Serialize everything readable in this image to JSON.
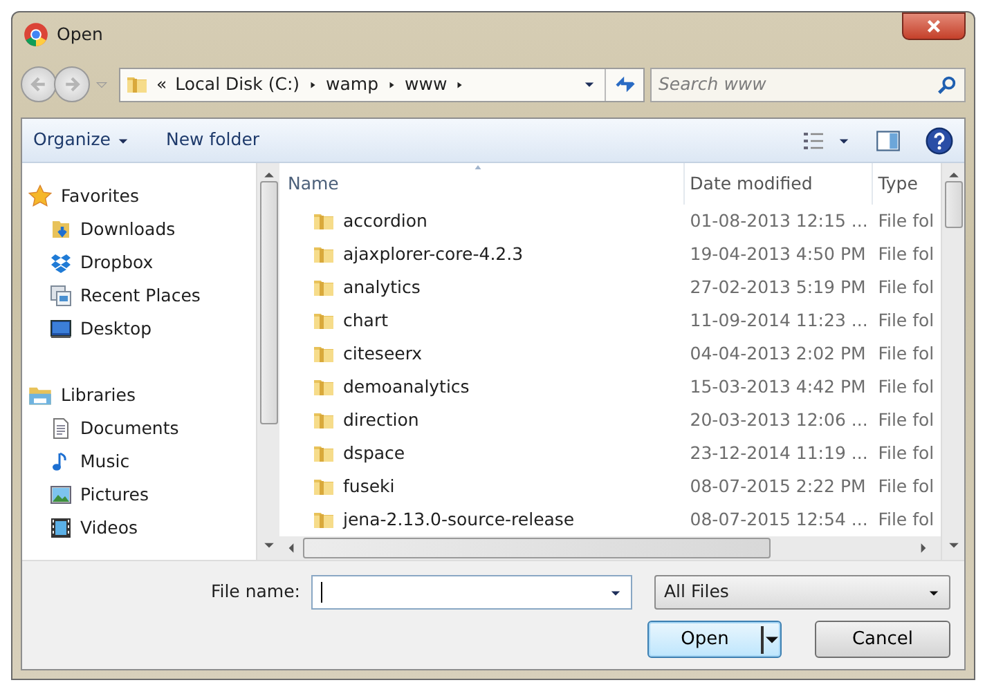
{
  "window": {
    "title": "Open"
  },
  "address": {
    "crumbs": [
      "«",
      "Local Disk (C:)",
      "wamp",
      "www"
    ]
  },
  "search": {
    "placeholder": "Search www"
  },
  "toolbar": {
    "organize": "Organize",
    "new_folder": "New folder"
  },
  "sidebar": {
    "groups": [
      {
        "label": "Favorites",
        "children": [
          {
            "label": "Downloads"
          },
          {
            "label": "Dropbox"
          },
          {
            "label": "Recent Places"
          },
          {
            "label": "Desktop"
          }
        ]
      },
      {
        "label": "Libraries",
        "children": [
          {
            "label": "Documents"
          },
          {
            "label": "Music"
          },
          {
            "label": "Pictures"
          },
          {
            "label": "Videos"
          }
        ]
      }
    ]
  },
  "table": {
    "columns": [
      "Name",
      "Date modified",
      "Type"
    ],
    "rows": [
      {
        "name": "accordion",
        "date": "01-08-2013 12:15 ...",
        "type": "File fol"
      },
      {
        "name": "ajaxplorer-core-4.2.3",
        "date": "19-04-2013 4:50 PM",
        "type": "File fol"
      },
      {
        "name": "analytics",
        "date": "27-02-2013 5:19 PM",
        "type": "File fol"
      },
      {
        "name": "chart",
        "date": "11-09-2014 11:23 ...",
        "type": "File fol"
      },
      {
        "name": "citeseerx",
        "date": "04-04-2013 2:02 PM",
        "type": "File fol"
      },
      {
        "name": "demoanalytics",
        "date": "15-03-2013 4:42 PM",
        "type": "File fol"
      },
      {
        "name": "direction",
        "date": "20-03-2013 12:06 ...",
        "type": "File fol"
      },
      {
        "name": "dspace",
        "date": "23-12-2014 11:19 ...",
        "type": "File fol"
      },
      {
        "name": "fuseki",
        "date": "08-07-2015 2:22 PM",
        "type": "File fol"
      },
      {
        "name": "jena-2.13.0-source-release",
        "date": "08-07-2015 12:54 ...",
        "type": "File fol"
      }
    ]
  },
  "file_name": {
    "label": "File name:"
  },
  "filter": {
    "value": "All Files"
  },
  "buttons": {
    "open": "Open",
    "cancel": "Cancel"
  }
}
